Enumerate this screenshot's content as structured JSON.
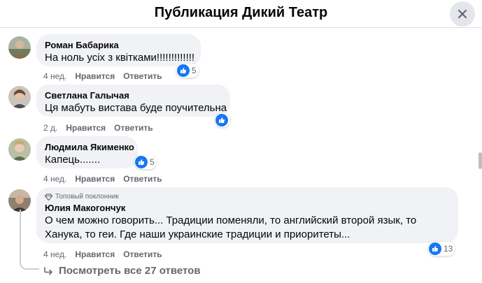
{
  "header": {
    "title": "Публикация Дикий Театр"
  },
  "comments": [
    {
      "author": "Роман Бабарика",
      "lines": [
        "На ноль усіх з квітками!!!!!!!!!!!!!"
      ],
      "time": "4 нед.",
      "like": "Нравится",
      "reply": "Ответить",
      "reactions": "5"
    },
    {
      "author": "Светлана Галычая",
      "lines": [
        "Ця мабуть вистава буде поучительна"
      ],
      "time": "2 д.",
      "like": "Нравится",
      "reply": "Ответить",
      "reactions": ""
    },
    {
      "author": "Людмила Якименко",
      "lines": [
        "Капець......."
      ],
      "time": "4 нед.",
      "like": "Нравится",
      "reply": "Ответить",
      "reactions": "5"
    },
    {
      "badge": "Топовый поклонник",
      "author": "Юлия Макогончук",
      "lines": [
        "О чем можно говорить... Традиции поменяли, то английский второй язык, то",
        "Ханука, то геи. Где наши украинские традиции и приоритеты..."
      ],
      "time": "4 нед.",
      "like": "Нравится",
      "reply": "Ответить",
      "reactions": "13"
    }
  ],
  "more_replies": "Посмотреть все 27 ответов",
  "icons": {
    "close": "close-icon",
    "like": "like-icon",
    "badge": "diamond-icon",
    "reply_arrow": "reply-arrow-icon"
  },
  "colors": {
    "accent": "#1877f2",
    "bubble": "#f0f2f5",
    "secondary_text": "#65676b"
  }
}
